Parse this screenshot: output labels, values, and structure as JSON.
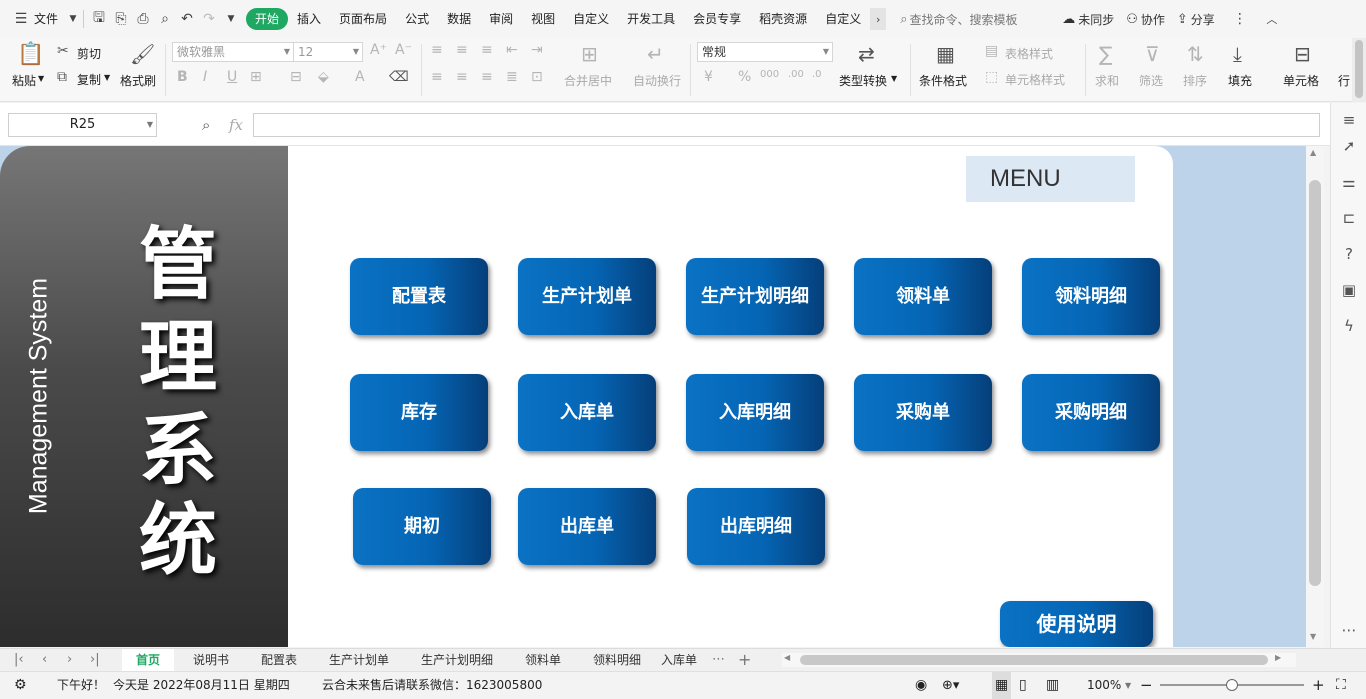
{
  "menubar": {
    "file_label": "文件",
    "tabs": [
      "开始",
      "插入",
      "页面布局",
      "公式",
      "数据",
      "审阅",
      "视图",
      "自定义",
      "开发工具",
      "会员专享",
      "稻壳资源",
      "自定义"
    ],
    "search_placeholder": "查找命令、搜索模板",
    "sync_label": "未同步",
    "collab_label": "协作",
    "share_label": "分享"
  },
  "ribbon": {
    "paste": "粘贴",
    "cut": "剪切",
    "copy": "复制",
    "format_painter": "格式刷",
    "font_name": "微软雅黑",
    "font_size": "12",
    "merge_center": "合并居中",
    "wrap_text": "自动换行",
    "number_format": "常规",
    "type_convert": "类型转换",
    "cond_format": "条件格式",
    "table_style": "表格样式",
    "cell_style": "单元格样式",
    "sum": "求和",
    "filter": "筛选",
    "sort": "排序",
    "fill": "填充",
    "cell": "单元格",
    "row_col": "行"
  },
  "formula_bar": {
    "cell_ref": "R25",
    "fx": "fx",
    "formula": ""
  },
  "sheet": {
    "title_en": "Management System",
    "title_cn_chars": [
      "管",
      "理",
      "系",
      "统"
    ],
    "menu_label": "MENU",
    "buttons": [
      {
        "label": "配置表"
      },
      {
        "label": "生产计划单"
      },
      {
        "label": "生产计划明细"
      },
      {
        "label": "领料单"
      },
      {
        "label": "领料明细"
      },
      {
        "label": "库存"
      },
      {
        "label": "入库单"
      },
      {
        "label": "入库明细"
      },
      {
        "label": "采购单"
      },
      {
        "label": "采购明细"
      },
      {
        "label": "期初"
      },
      {
        "label": "出库单"
      },
      {
        "label": "出库明细"
      }
    ],
    "help_button": "使用说明"
  },
  "sheet_tabs": [
    {
      "label": "首页",
      "active": true
    },
    {
      "label": "说明书"
    },
    {
      "label": "配置表"
    },
    {
      "label": "生产计划单"
    },
    {
      "label": "生产计划明细"
    },
    {
      "label": "领料单"
    },
    {
      "label": "领料明细"
    },
    {
      "label": "入库单"
    }
  ],
  "status": {
    "greeting": "下午好！",
    "today": "今天是 2022年08月11日 星期四",
    "contact": "云合未来售后请联系微信：1623005800",
    "zoom": "100%"
  }
}
